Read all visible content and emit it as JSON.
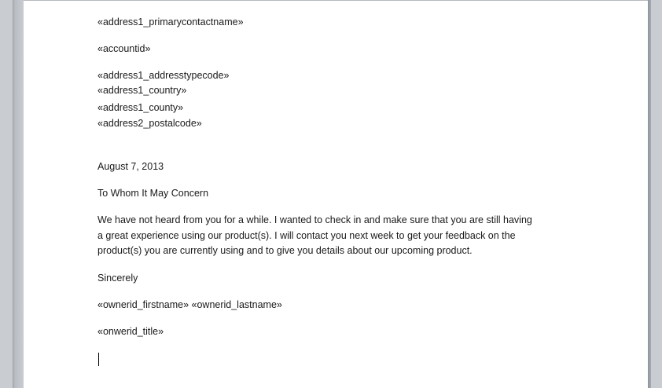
{
  "document": {
    "merge_fields": {
      "primary_contact": "«address1_primarycontactname»",
      "account_id": "«accountid»",
      "address_lines": [
        "«address1_addresstypecode»",
        "«address1_country»",
        "«address1_county»",
        "«address2_postalcode»"
      ]
    },
    "date": "August 7, 2013",
    "salutation": "To Whom It May Concern",
    "body_lines": [
      "We have not heard from you for a while. I wanted to check in and make sure that you are still having",
      "a great experience using our product(s). I will contact you next week to get your feedback on the",
      "product(s) you are currently using and to give you details about our upcoming product."
    ],
    "closing": "Sincerely",
    "signature_name": "«ownerid_firstname» «ownerid_lastname»",
    "signature_title": "«onwerid_title»"
  }
}
